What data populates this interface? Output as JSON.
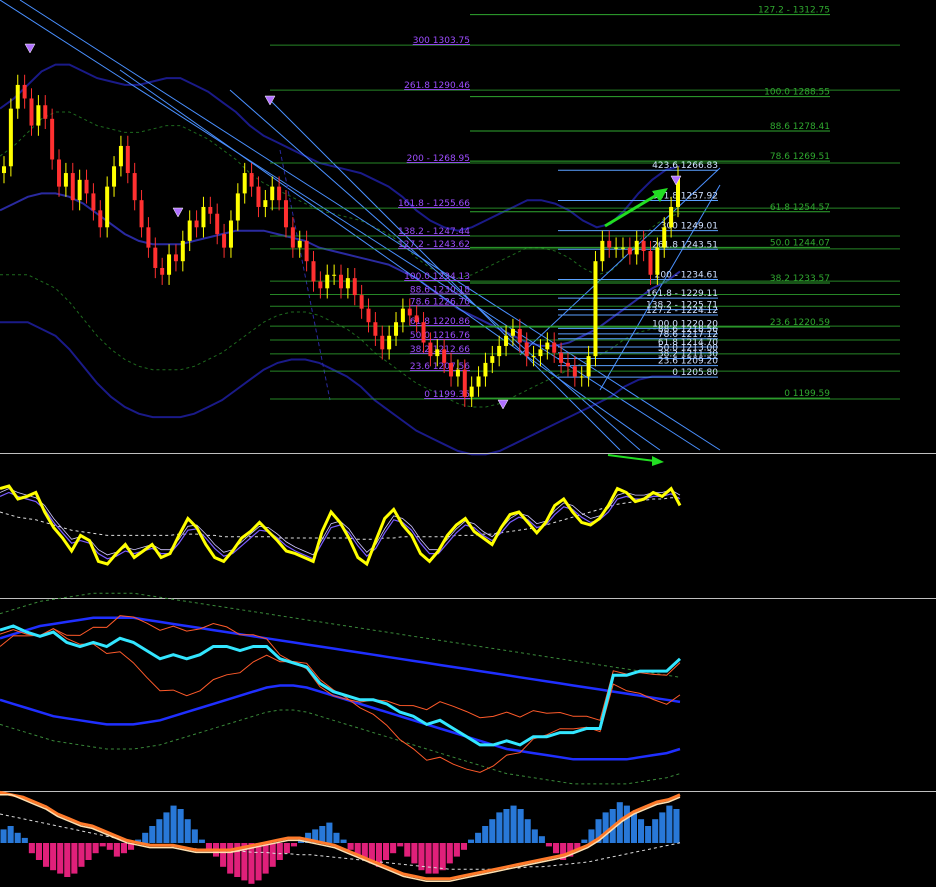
{
  "chart_data": [
    {
      "type": "line",
      "pane": "price",
      "colors": {
        "bull": "#ffff00",
        "bear": "#ff3030",
        "fib_left": "#9d4dff",
        "fib_right": "#2fa82f",
        "fib_small": "#5aa0ff",
        "channel": "#4a90ff",
        "band_outer": "#1a1a88",
        "band_mid": "#2a2aa0",
        "arrow": "#22dd22"
      },
      "fib_left": [
        {
          "label": "300 1303.75"
        },
        {
          "label": "261.8 1290.46"
        },
        {
          "label": "200 - 1268.95"
        },
        {
          "label": "161.8 - 1255.66"
        },
        {
          "label": "138.2 - 1247.44"
        },
        {
          "label": "127.2 - 1243.62"
        },
        {
          "label": "100.0 1234.13"
        },
        {
          "label": "88.6 1230.18"
        },
        {
          "label": "78.6 1226.70"
        },
        {
          "label": "61.8 1220.86"
        },
        {
          "label": "50.0 1216.76"
        },
        {
          "label": "38.2 1212.66"
        },
        {
          "label": "23.6 1207.56"
        },
        {
          "label": "0 1199.35"
        }
      ],
      "fib_right": [
        {
          "label": "127.2 - 1312.75"
        },
        {
          "label": "100.0 1288.55"
        },
        {
          "label": "88.6 1278.41"
        },
        {
          "label": "78.6 1269.51"
        },
        {
          "label": "61.8 1254.57"
        },
        {
          "label": "50.0 1244.07"
        },
        {
          "label": "38.2 1233.57"
        },
        {
          "label": "23.6 1220.59"
        },
        {
          "label": "0 1199.59"
        }
      ],
      "fib_small": [
        {
          "label": "423.6 1266.83"
        },
        {
          "label": "361.8 1257.92"
        },
        {
          "label": "300 1249.01"
        },
        {
          "label": "261.8 1243.51"
        },
        {
          "label": "200 - 1234.61"
        },
        {
          "label": "161.8 - 1229.11"
        },
        {
          "label": "138.2 - 1225.71"
        },
        {
          "label": "127.2 - 1224.12"
        },
        {
          "label": "100.0 1220.20"
        },
        {
          "label": "88.6 1218.56"
        },
        {
          "label": "78.6 1217.12"
        },
        {
          "label": "61.8 1214.70"
        },
        {
          "label": "50.0 1213.00"
        },
        {
          "label": "38.2 1211.30"
        },
        {
          "label": "23.6 1209.20"
        },
        {
          "label": "0 1205.80"
        }
      ],
      "candles_close": [
        1268,
        1285,
        1292,
        1288,
        1280,
        1286,
        1282,
        1270,
        1262,
        1266,
        1258,
        1264,
        1260,
        1255,
        1250,
        1262,
        1268,
        1274,
        1266,
        1258,
        1250,
        1244,
        1238,
        1236,
        1242,
        1240,
        1246,
        1252,
        1250,
        1256,
        1254,
        1248,
        1244,
        1252,
        1260,
        1266,
        1262,
        1256,
        1258,
        1262,
        1258,
        1250,
        1244,
        1246,
        1240,
        1234,
        1232,
        1236,
        1236,
        1232,
        1235,
        1230,
        1226,
        1222,
        1218,
        1214,
        1218,
        1222,
        1226,
        1224,
        1222,
        1216,
        1212,
        1214,
        1210,
        1206,
        1208,
        1200,
        1203,
        1206,
        1210,
        1212,
        1215,
        1218,
        1220,
        1216,
        1212,
        1212,
        1214,
        1216,
        1213,
        1210,
        1209,
        1206,
        1206,
        1212,
        1240,
        1246,
        1244,
        1244,
        1244,
        1242,
        1246,
        1243,
        1236,
        1244,
        1250,
        1256,
        1265
      ],
      "bands": {
        "mid": [
          1255,
          1257,
          1259,
          1260,
          1260,
          1259,
          1257,
          1254,
          1251,
          1248,
          1246,
          1245,
          1245,
          1245,
          1246,
          1247,
          1248,
          1249,
          1249,
          1249,
          1248,
          1247,
          1246,
          1244,
          1243,
          1242,
          1241,
          1240,
          1239,
          1237,
          1235,
          1232,
          1229,
          1226,
          1224,
          1222,
          1220,
          1218,
          1216,
          1215,
          1215,
          1216,
          1218,
          1220,
          1223,
          1226,
          1229,
          1232,
          1234,
          1237
        ],
        "upper": [
          1285,
          1288,
          1292,
          1296,
          1298,
          1298,
          1296,
          1294,
          1293,
          1292,
          1292,
          1293,
          1294,
          1294,
          1292,
          1290,
          1287,
          1284,
          1280,
          1277,
          1275,
          1273,
          1271,
          1269,
          1268,
          1267,
          1266,
          1264,
          1262,
          1259,
          1255,
          1252,
          1250,
          1249,
          1250,
          1252,
          1254,
          1256,
          1258,
          1258,
          1257,
          1255,
          1252,
          1250,
          1251,
          1255,
          1260,
          1264,
          1267,
          1268
        ],
        "lower": [
          1222,
          1222,
          1222,
          1220,
          1218,
          1214,
          1209,
          1204,
          1200,
          1197,
          1195,
          1194,
          1194,
          1194,
          1195,
          1197,
          1199,
          1202,
          1205,
          1208,
          1210,
          1211,
          1211,
          1210,
          1208,
          1206,
          1203,
          1199,
          1196,
          1193,
          1190,
          1188,
          1186,
          1184,
          1183,
          1183,
          1184,
          1186,
          1188,
          1190,
          1192,
          1194,
          1196,
          1198,
          1200,
          1203,
          1205,
          1206,
          1206,
          1206
        ]
      }
    },
    {
      "type": "line",
      "pane": "oscillator",
      "colors": {
        "main": "#ffff00",
        "signal": "#7a5cff",
        "signal2": "#cfc6ff",
        "ma": "#dddddd",
        "arrow": "#22dd22"
      },
      "main": [
        78,
        80,
        70,
        72,
        75,
        60,
        48,
        40,
        30,
        42,
        38,
        22,
        20,
        28,
        35,
        25,
        30,
        35,
        25,
        28,
        42,
        55,
        48,
        35,
        25,
        22,
        30,
        40,
        45,
        52,
        45,
        38,
        30,
        28,
        25,
        22,
        45,
        60,
        52,
        40,
        25,
        20,
        38,
        55,
        62,
        50,
        42,
        28,
        22,
        30,
        42,
        50,
        55,
        45,
        40,
        35,
        48,
        58,
        60,
        52,
        44,
        52,
        65,
        70,
        60,
        52,
        50,
        55,
        65,
        78,
        75,
        68,
        70,
        75,
        72,
        78,
        65
      ],
      "signal": [
        72,
        75,
        72,
        70,
        68,
        62,
        52,
        44,
        36,
        38,
        36,
        28,
        24,
        26,
        30,
        28,
        30,
        32,
        28,
        28,
        36,
        46,
        47,
        40,
        32,
        26,
        28,
        34,
        40,
        46,
        45,
        40,
        34,
        30,
        27,
        24,
        36,
        48,
        50,
        44,
        34,
        26,
        32,
        44,
        54,
        52,
        46,
        36,
        28,
        28,
        36,
        44,
        50,
        48,
        42,
        38,
        44,
        52,
        56,
        54,
        48,
        50,
        58,
        64,
        62,
        56,
        52,
        54,
        60,
        70,
        72,
        70,
        70,
        72,
        72,
        74,
        70
      ],
      "ma": [
        60,
        58,
        56,
        55,
        54,
        52,
        50,
        48,
        46,
        45,
        44,
        43,
        42,
        42,
        42,
        42,
        42,
        42,
        42,
        42,
        43,
        43,
        43,
        42,
        42,
        41,
        41,
        41,
        41,
        41,
        41,
        40,
        40,
        40,
        40,
        40,
        40,
        40,
        40,
        40,
        39,
        39,
        39,
        40,
        40,
        41,
        41,
        41,
        41,
        41,
        41,
        42,
        42,
        42,
        43,
        43,
        44,
        45,
        46,
        47,
        48,
        50,
        52,
        54,
        56,
        58,
        60,
        62,
        64,
        66,
        67,
        68,
        69,
        70,
        70,
        71,
        71
      ]
    },
    {
      "type": "line",
      "pane": "bands-indicator",
      "colors": {
        "main": "#33e6ff",
        "band": "#1f2fff",
        "inner": "#ff5a2a",
        "outer": "#3a8a3a"
      },
      "main": [
        78,
        80,
        77,
        75,
        77,
        72,
        70,
        72,
        70,
        74,
        72,
        68,
        64,
        66,
        64,
        66,
        70,
        70,
        68,
        70,
        70,
        64,
        62,
        60,
        52,
        48,
        46,
        44,
        44,
        42,
        38,
        36,
        32,
        34,
        30,
        26,
        22,
        22,
        24,
        22,
        26,
        26,
        28,
        28,
        30,
        30,
        56,
        56,
        58,
        58,
        58,
        64
      ],
      "band_upper": [
        74,
        76,
        78,
        80,
        81,
        82,
        83,
        84,
        84,
        84,
        84,
        83,
        82,
        81,
        80,
        79,
        78,
        77,
        76,
        75,
        74,
        73,
        72,
        71,
        70,
        69,
        68,
        67,
        66,
        65,
        64,
        63,
        62,
        61,
        60,
        59,
        58,
        57,
        56,
        55,
        54,
        53,
        52,
        51,
        50,
        49,
        48,
        47,
        46,
        45,
        44,
        43
      ],
      "band_lower": [
        44,
        42,
        40,
        38,
        36,
        35,
        34,
        33,
        32,
        32,
        32,
        33,
        34,
        36,
        38,
        40,
        42,
        44,
        46,
        48,
        50,
        51,
        51,
        50,
        48,
        46,
        44,
        42,
        40,
        38,
        36,
        34,
        32,
        30,
        28,
        26,
        24,
        22,
        20,
        19,
        18,
        17,
        16,
        15,
        15,
        15,
        15,
        15,
        16,
        17,
        18,
        20
      ]
    },
    {
      "type": "bar",
      "pane": "histogram",
      "colors": {
        "pos": "#2878d8",
        "neg": "#e0207a",
        "line1": "#ff7a2a",
        "line2": "#ffe0b0",
        "ma": "#dddddd"
      },
      "values": [
        8,
        10,
        6,
        3,
        -6,
        -10,
        -14,
        -16,
        -18,
        -20,
        -18,
        -14,
        -10,
        -6,
        -2,
        -4,
        -8,
        -6,
        -4,
        2,
        6,
        10,
        14,
        18,
        22,
        20,
        14,
        8,
        2,
        -4,
        -8,
        -14,
        -18,
        -20,
        -22,
        -24,
        -22,
        -18,
        -14,
        -10,
        -6,
        -2,
        2,
        6,
        8,
        10,
        12,
        6,
        2,
        -4,
        -8,
        -10,
        -12,
        -14,
        -10,
        -6,
        -2,
        -8,
        -12,
        -16,
        -18,
        -18,
        -16,
        -12,
        -8,
        -4,
        2,
        6,
        10,
        14,
        18,
        20,
        22,
        20,
        14,
        8,
        4,
        -2,
        -6,
        -10,
        -8,
        -4,
        2,
        8,
        14,
        18,
        20,
        24,
        22,
        18,
        14,
        10,
        14,
        18,
        22,
        20
      ],
      "line1": [
        78,
        76,
        74,
        70,
        66,
        60,
        56,
        52,
        50,
        46,
        42,
        38,
        36,
        34,
        34,
        34,
        32,
        30,
        30,
        30,
        30,
        32,
        34,
        36,
        38,
        40,
        40,
        38,
        36,
        34,
        30,
        26,
        22,
        18,
        14,
        10,
        8,
        6,
        6,
        6,
        8,
        10,
        12,
        14,
        16,
        18,
        20,
        22,
        24,
        26,
        30,
        34,
        40,
        48,
        56,
        62,
        66,
        70,
        72,
        76
      ],
      "line2": [
        76,
        76,
        72,
        68,
        64,
        58,
        54,
        50,
        48,
        44,
        40,
        36,
        34,
        32,
        32,
        32,
        30,
        28,
        28,
        28,
        28,
        30,
        32,
        34,
        36,
        38,
        38,
        36,
        34,
        32,
        28,
        24,
        20,
        16,
        12,
        8,
        6,
        4,
        4,
        4,
        6,
        8,
        10,
        12,
        14,
        16,
        18,
        20,
        22,
        24,
        28,
        32,
        38,
        46,
        54,
        60,
        64,
        68,
        70,
        74
      ],
      "ma": [
        60,
        58,
        56,
        54,
        52,
        50,
        48,
        46,
        44,
        42,
        40,
        38,
        36,
        35,
        34,
        33,
        32,
        31,
        30,
        30,
        29,
        29,
        28,
        28,
        27,
        27,
        26,
        26,
        25,
        24,
        23,
        22,
        21,
        20,
        19,
        18,
        17,
        16,
        15,
        14,
        14,
        14,
        14,
        14,
        15,
        15,
        16,
        16,
        17,
        18,
        19,
        20,
        22,
        24,
        26,
        28,
        30,
        32,
        34,
        36
      ]
    }
  ]
}
